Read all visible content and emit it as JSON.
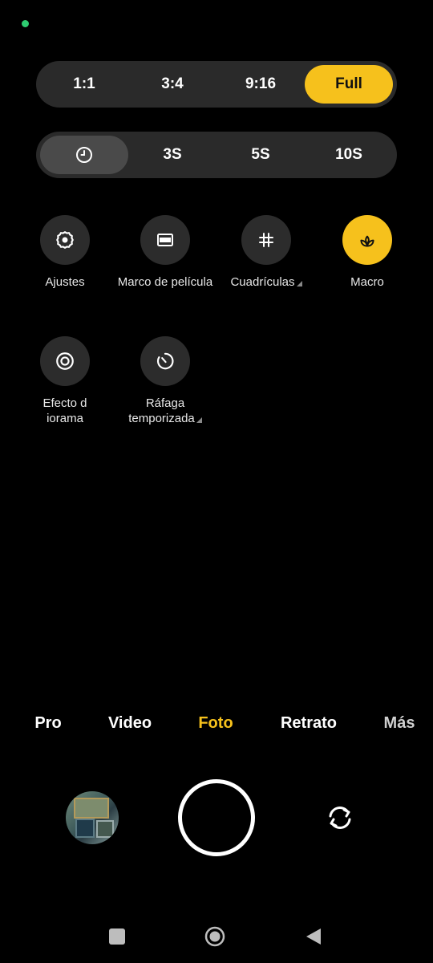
{
  "aspect_ratio": {
    "options": [
      "1:1",
      "3:4",
      "9:16",
      "Full"
    ],
    "selected": "Full"
  },
  "timer": {
    "options": [
      "3S",
      "5S",
      "10S"
    ],
    "selected": "off"
  },
  "settings": [
    {
      "label": "Ajustes",
      "icon": "settings-gear-icon"
    },
    {
      "label": "Marco de película",
      "icon": "film-frame-icon"
    },
    {
      "label": "Cuadrículas",
      "icon": "grid-icon"
    },
    {
      "label": "Macro",
      "icon": "macro-flower-icon",
      "active": true
    },
    {
      "label": "Efecto d iorama",
      "icon": "diorama-icon"
    },
    {
      "label": "Ráfaga temporizada",
      "icon": "timed-burst-icon"
    }
  ],
  "modes": {
    "items": [
      "Pro",
      "Video",
      "Foto",
      "Retrato",
      "Más"
    ],
    "selected": "Foto"
  },
  "colors": {
    "accent": "#f6c11c",
    "panel": "#2a2a2a",
    "indicator": "#2ecc71"
  }
}
